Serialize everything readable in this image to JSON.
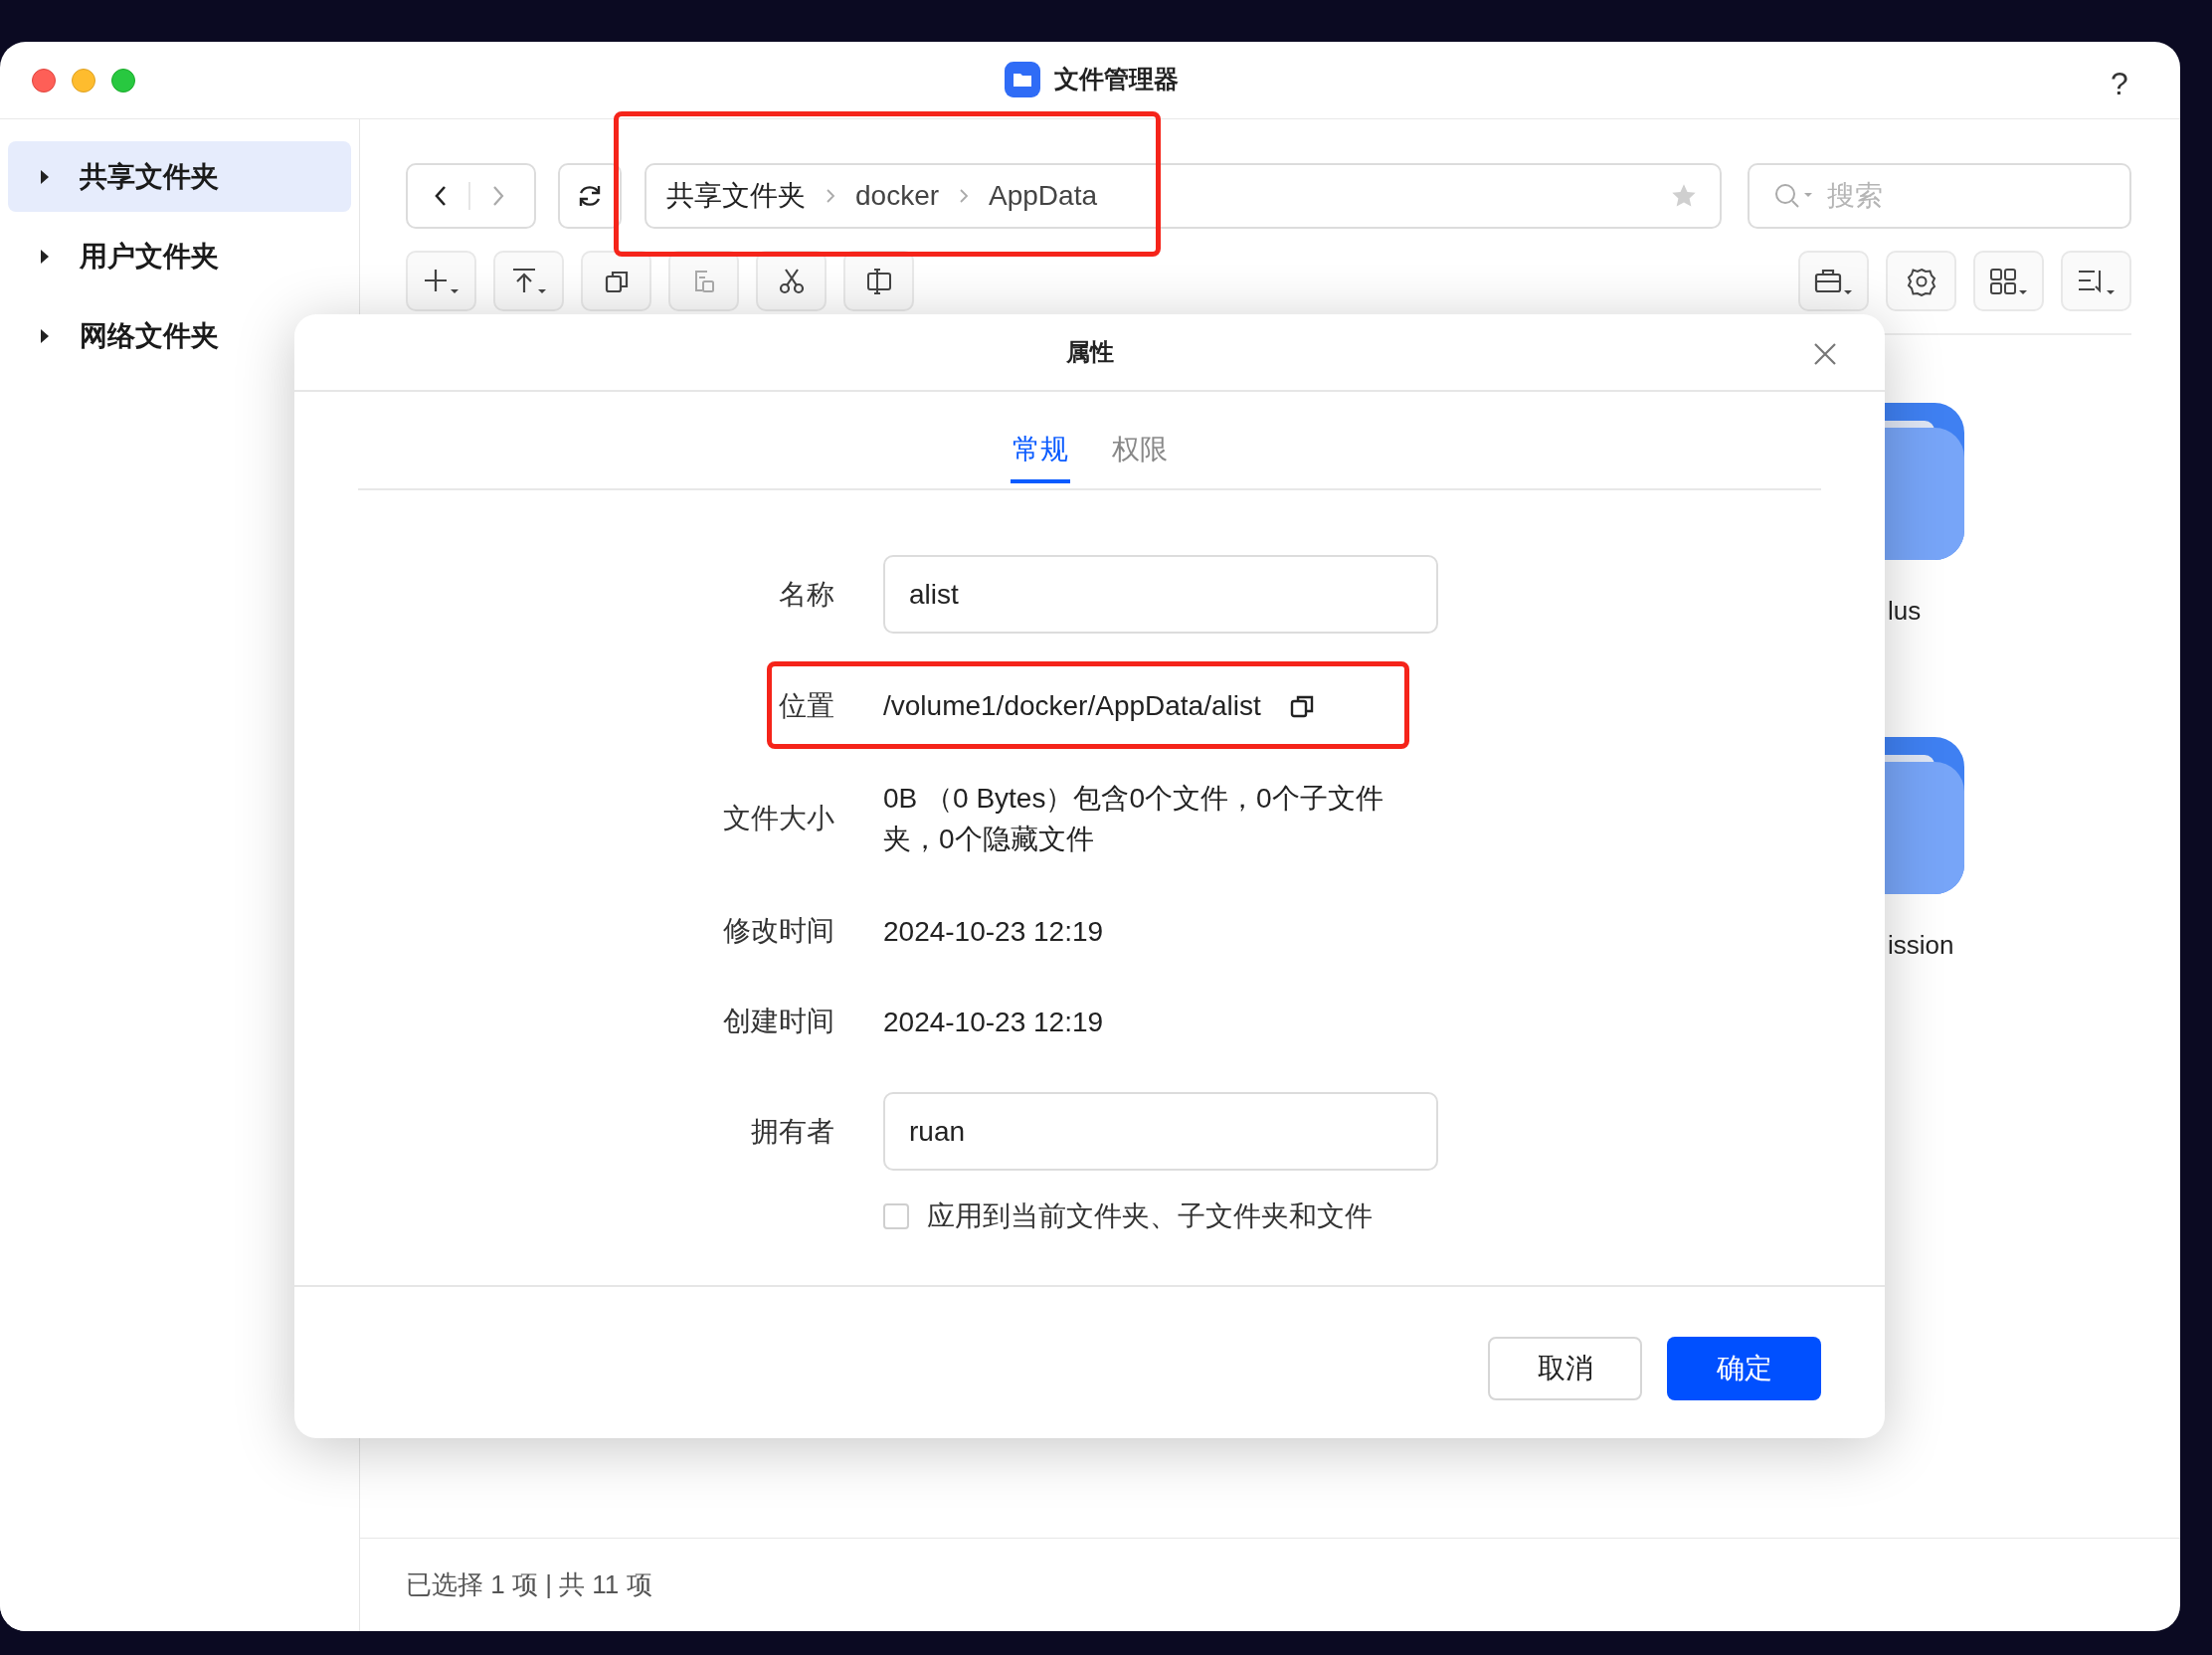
{
  "window": {
    "title": "文件管理器",
    "help": "?"
  },
  "sidebar": {
    "items": [
      {
        "label": "共享文件夹",
        "selected": true
      },
      {
        "label": "用户文件夹",
        "selected": false
      },
      {
        "label": "网络文件夹",
        "selected": false
      }
    ]
  },
  "toolbar": {
    "breadcrumb": [
      "共享文件夹",
      "docker",
      "AppData"
    ],
    "search": {
      "placeholder": "搜索"
    }
  },
  "files": [
    {
      "name": "lus"
    },
    {
      "name": "ission"
    }
  ],
  "dialog": {
    "title": "属性",
    "tabs": [
      {
        "label": "常规",
        "selected": true
      },
      {
        "label": "权限",
        "selected": false
      }
    ],
    "fields": [
      {
        "kind": "input",
        "label": "名称",
        "value": "alist"
      },
      {
        "kind": "copy",
        "label": "位置",
        "value": "/volume1/docker/AppData/alist"
      },
      {
        "kind": "text",
        "label": "文件大小",
        "value": "0B （0 Bytes）包含0个文件，0个子文件夹，0个隐藏文件"
      },
      {
        "kind": "text",
        "label": "修改时间",
        "value": "2024-10-23 12:19"
      },
      {
        "kind": "text",
        "label": "创建时间",
        "value": "2024-10-23 12:19"
      },
      {
        "kind": "input",
        "label": "拥有者",
        "value": "ruan"
      }
    ],
    "apply": {
      "label": "应用到当前文件夹、子文件夹和文件",
      "checked": false
    },
    "buttons": [
      {
        "label": "取消",
        "kind": "secondary"
      },
      {
        "label": "确定",
        "kind": "primary"
      }
    ]
  },
  "status_bar": "已选择 1 项 | 共 11 项"
}
